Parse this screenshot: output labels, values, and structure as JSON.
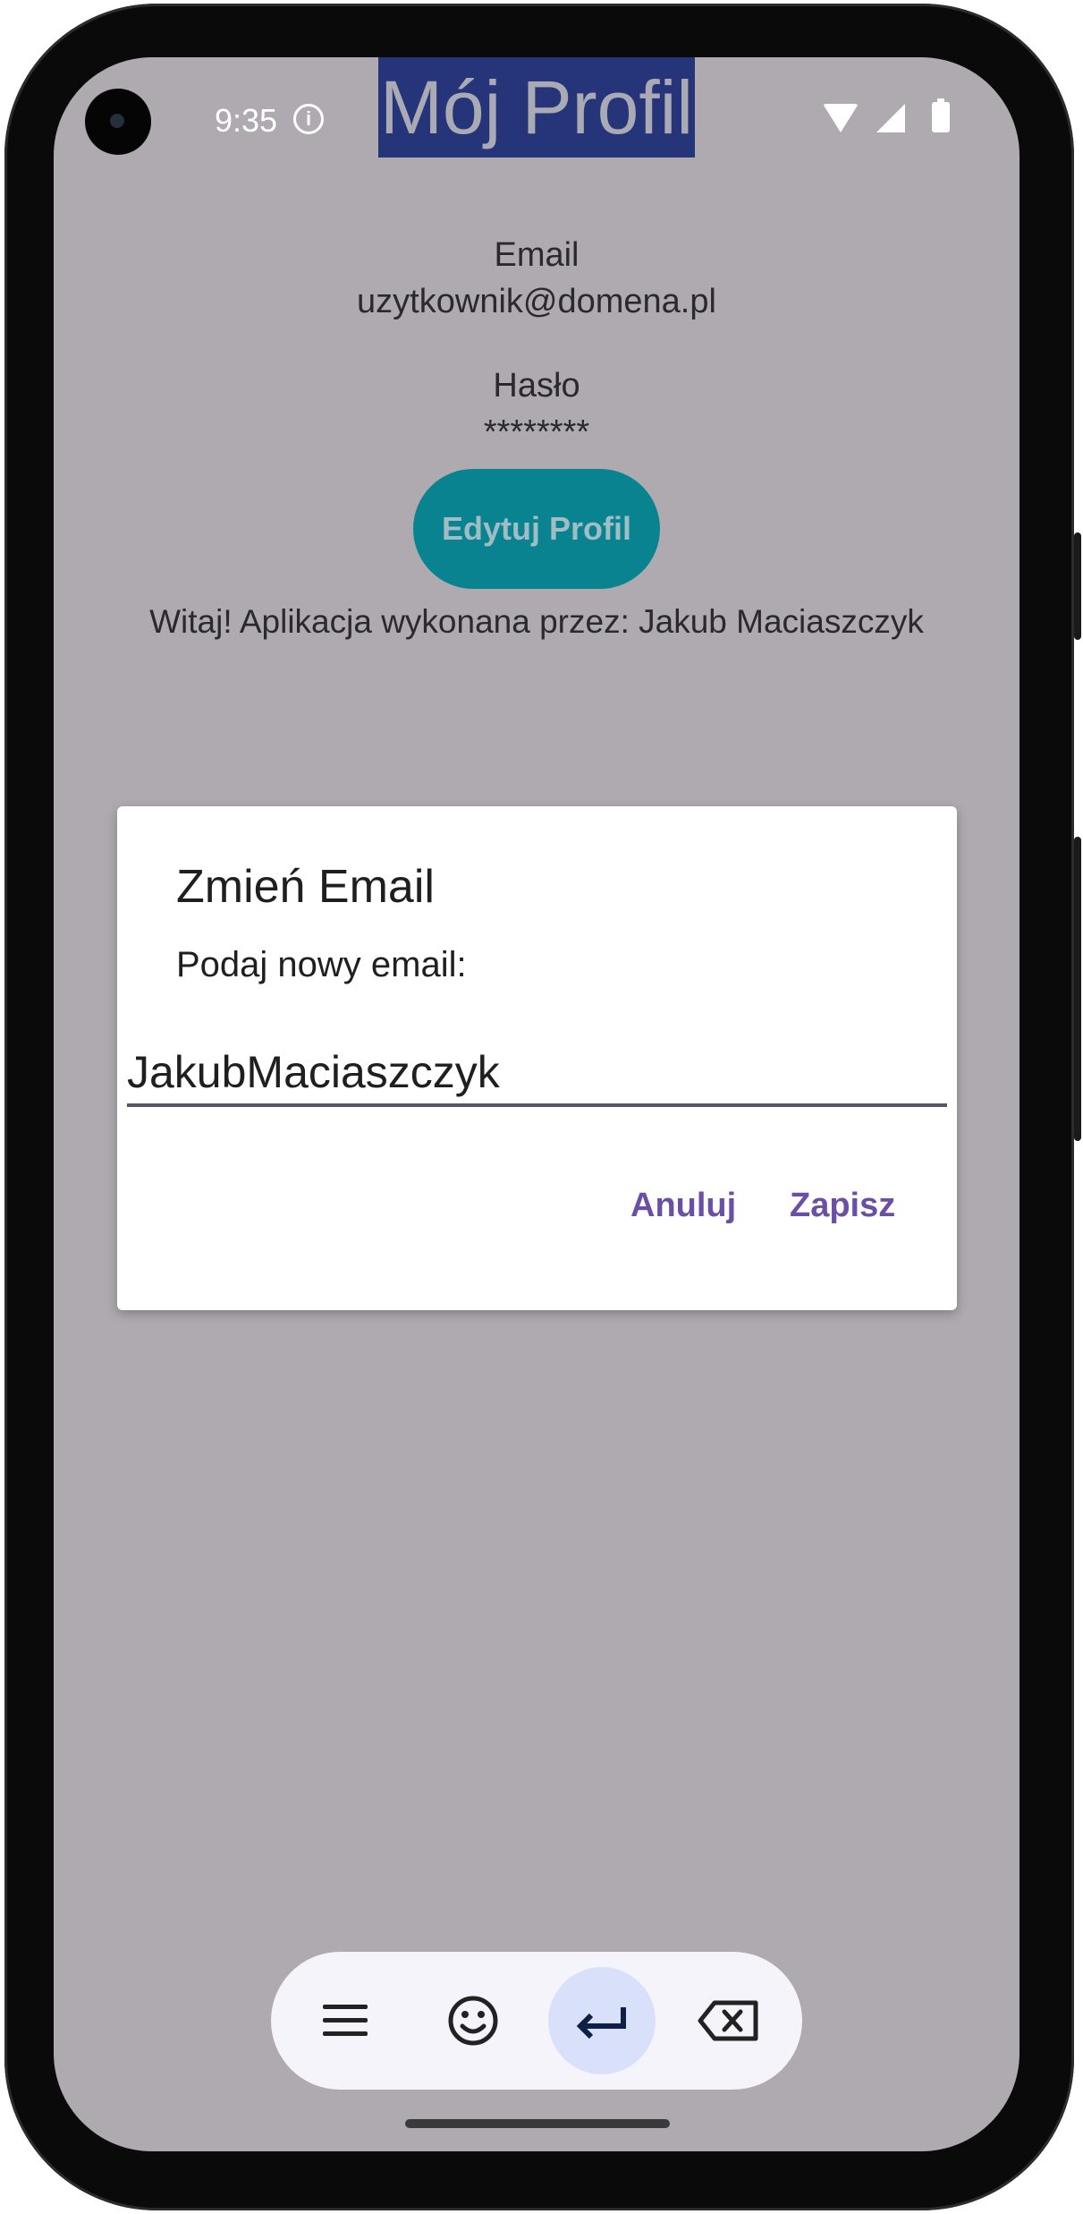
{
  "status_bar": {
    "time": "9:35"
  },
  "header": {
    "title": "Mój Profil"
  },
  "profile": {
    "email_label": "Email",
    "email_value": "uzytkownik@domena.pl",
    "password_label": "Hasło",
    "password_value": "********",
    "edit_button_label": "Edytuj Profil",
    "welcome_text": "Witaj! Aplikacja wykonana przez: Jakub Maciaszczyk"
  },
  "dialog": {
    "title": "Zmień Email",
    "message": "Podaj nowy email:",
    "input_value": "JakubMaciaszczyk",
    "cancel_label": "Anuluj",
    "save_label": "Zapisz"
  },
  "keyboard_toolbar": {
    "keys": [
      "menu-icon",
      "emoji-icon",
      "enter-icon",
      "backspace-icon"
    ],
    "active_key": "enter-icon"
  },
  "colors": {
    "screen_background": "#aeaaaf",
    "title_background": "#26357a",
    "edit_button": "#0a8390",
    "dialog_button_text": "#6b4fa6",
    "active_key": "#d9e1fa"
  }
}
